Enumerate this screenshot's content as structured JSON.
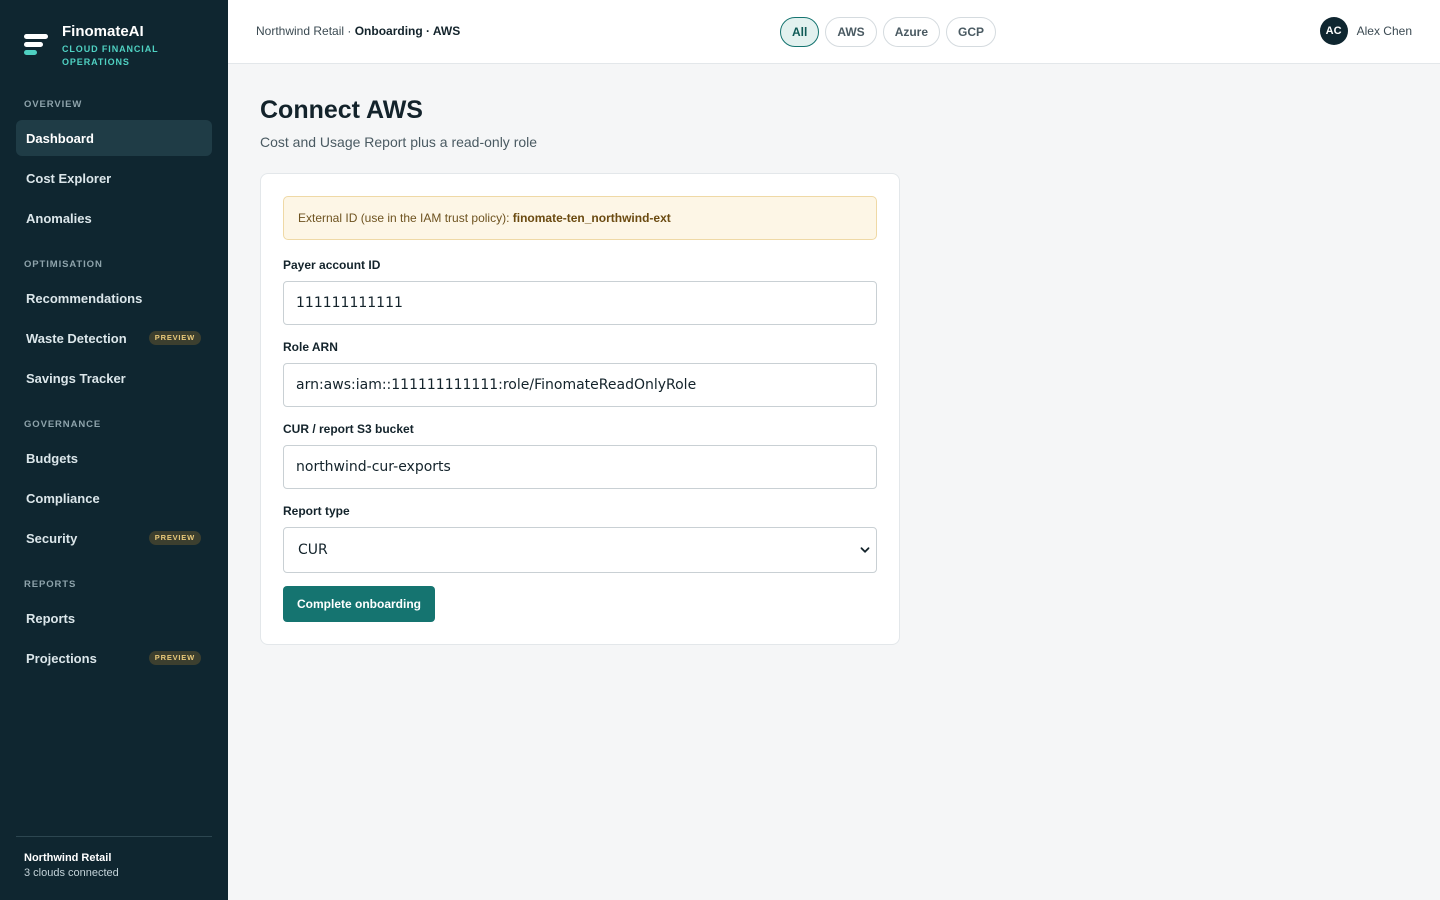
{
  "brand": {
    "name": "FinomateAI",
    "subtitle": "CLOUD FINANCIAL OPERATIONS"
  },
  "sidebar": {
    "sections": [
      {
        "label": "OVERVIEW"
      },
      {
        "label": "OPTIMISATION"
      },
      {
        "label": "GOVERNANCE"
      },
      {
        "label": "REPORTS"
      }
    ],
    "items": [
      {
        "label": "Dashboard",
        "active": true
      },
      {
        "label": "Cost Explorer"
      },
      {
        "label": "Anomalies"
      },
      {
        "label": "Recommendations"
      },
      {
        "label": "Waste Detection",
        "badge": "PREVIEW"
      },
      {
        "label": "Savings Tracker"
      },
      {
        "label": "Budgets"
      },
      {
        "label": "Compliance"
      },
      {
        "label": "Security",
        "badge": "PREVIEW"
      },
      {
        "label": "Reports"
      },
      {
        "label": "Projections",
        "badge": "PREVIEW"
      }
    ],
    "footer": {
      "org": "Northwind Retail",
      "status": "3 clouds connected"
    }
  },
  "header": {
    "breadcrumb": {
      "org": "Northwind Retail",
      "separator": " · ",
      "current": "Onboarding · AWS"
    },
    "filters": [
      {
        "label": "All",
        "active": true
      },
      {
        "label": "AWS"
      },
      {
        "label": "Azure"
      },
      {
        "label": "GCP"
      }
    ],
    "user": {
      "initials": "AC",
      "name": "Alex Chen"
    }
  },
  "main": {
    "title": "Connect AWS",
    "subtitle": "Cost and Usage Report plus a read-only role",
    "notice": {
      "text": "External ID (use in the IAM trust policy): ",
      "external_id": "finomate-ten_northwind-ext"
    },
    "fields": {
      "payer": {
        "label": "Payer account ID",
        "value": "111111111111"
      },
      "role": {
        "label": "Role ARN",
        "value": "arn:aws:iam::111111111111:role/FinomateReadOnlyRole"
      },
      "bucket": {
        "label": "CUR / report S3 bucket",
        "value": "northwind-cur-exports"
      },
      "report_type": {
        "label": "Report type",
        "value": "CUR"
      }
    },
    "submit_label": "Complete onboarding"
  },
  "colors": {
    "sidebar_bg": "#0f2630",
    "accent": "#157470",
    "accent_light": "#4fd1c2",
    "badge_text": "#e9c97a",
    "notice_bg": "#fdf6e6"
  },
  "icons": {
    "logo": "stacked-bars-logo-icon",
    "select": "chevron-down-icon"
  }
}
